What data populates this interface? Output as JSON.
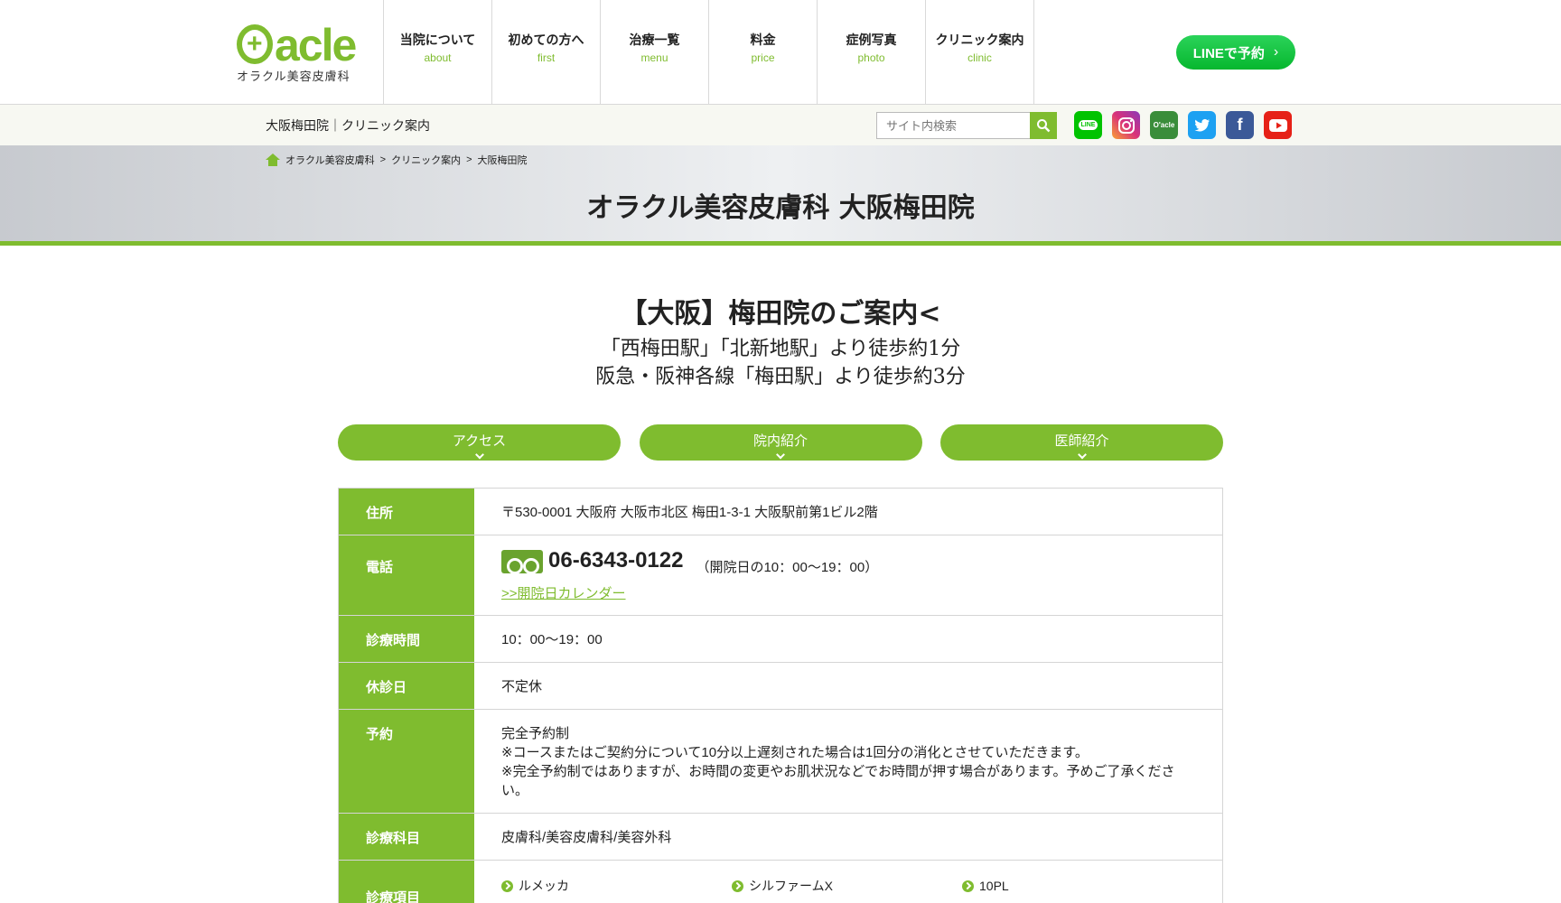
{
  "logo": {
    "mark": "acle",
    "sub": "オラクル美容皮膚科"
  },
  "gnav": [
    {
      "jp": "当院について",
      "en": "about"
    },
    {
      "jp": "初めての方へ",
      "en": "first"
    },
    {
      "jp": "治療一覧",
      "en": "menu"
    },
    {
      "jp": "料金",
      "en": "price"
    },
    {
      "jp": "症例写真",
      "en": "photo"
    },
    {
      "jp": "クリニック案内",
      "en": "clinic"
    }
  ],
  "line_button": {
    "label": "LINEで予約",
    "chev": "›"
  },
  "subbar": {
    "title": "大阪梅田院｜クリニック案内",
    "search_placeholder": "サイト内検索"
  },
  "social": {
    "line": "LINE",
    "oracle": "O'acle",
    "facebook": "f"
  },
  "breadcrumb": {
    "home": "オラクル美容皮膚科",
    "sep": ">",
    "clinic": "クリニック案内",
    "current": "大阪梅田院"
  },
  "hero": {
    "title": "オラクル美容皮膚科 大阪梅田院"
  },
  "intro": {
    "heading": "【大阪】梅田院のご案内<",
    "line1": "「西梅田駅」「北新地駅」より徒歩約1分",
    "line2": "阪急・阪神各線「梅田駅」より徒歩約3分"
  },
  "anchors": [
    "アクセス",
    "院内紹介",
    "医師紹介"
  ],
  "info": {
    "address": {
      "label": "住所",
      "value": "〒530-0001 大阪府 大阪市北区 梅田1-3-1 大阪駅前第1ビル2階"
    },
    "tel": {
      "label": "電話",
      "number": "06-6343-0122",
      "note": "（開院日の10：00～19：00）",
      "calendar_link": ">>開院日カレンダー"
    },
    "hours": {
      "label": "診療時間",
      "value": "10：00～19：00"
    },
    "closed": {
      "label": "休診日",
      "value": "不定休"
    },
    "reservation": {
      "label": "予約",
      "line1": "完全予約制",
      "line2": "※コースまたはご契約分について10分以上遅刻された場合は1回分の消化とさせていただきます。",
      "line3": "※完全予約制ではありますが、お時間の変更やお肌状況などでお時間が押す場合があります。予めご了承ください。"
    },
    "departments": {
      "label": "診療科目",
      "value": "皮膚科/美容皮膚科/美容外科"
    },
    "treatments": {
      "label": "診療項目",
      "items": [
        "ルメッカ",
        "シルファームX",
        "10PL"
      ]
    }
  },
  "colors": {
    "accent": "#7fbc2f",
    "line": "#06b72e"
  }
}
